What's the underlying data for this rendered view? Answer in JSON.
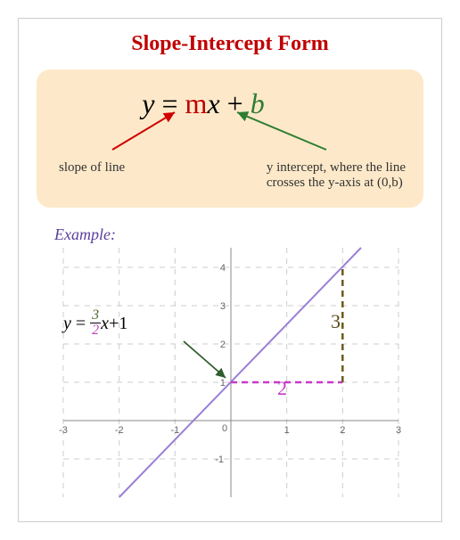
{
  "title": "Slope-Intercept Form",
  "equation": {
    "y": "y",
    "eq": " = ",
    "m": "m",
    "x": "x",
    "plus": " + ",
    "b": "b"
  },
  "annotations": {
    "slope": "slope of line",
    "intercept_line1": "y intercept, where the line",
    "intercept_line2": "crosses the y-axis at (0,b)"
  },
  "example": {
    "label": "Example:",
    "eq_y": "y",
    "eq_eq": " = ",
    "eq_frac_num": "3",
    "eq_frac_den": "2",
    "eq_x": "x",
    "eq_plus": "+",
    "eq_c": "1",
    "rise": "3",
    "run": "2"
  },
  "chart_data": {
    "type": "line",
    "title": "Example: y = (3/2)x + 1",
    "xlabel": "",
    "ylabel": "",
    "xlim": [
      -3,
      3
    ],
    "ylim": [
      -2,
      4.5
    ],
    "x_ticks": [
      -3,
      -2,
      -1,
      0,
      1,
      2,
      3
    ],
    "y_ticks": [
      -1,
      0,
      1,
      2,
      3,
      4
    ],
    "series": [
      {
        "name": "y=(3/2)x+1",
        "slope": 1.5,
        "intercept": 1,
        "points": [
          [
            -2,
            -2
          ],
          [
            0,
            1
          ],
          [
            2,
            4
          ]
        ]
      }
    ],
    "annotations": {
      "rise": {
        "from": [
          2,
          1
        ],
        "to": [
          2,
          4
        ],
        "value": 3
      },
      "run": {
        "from": [
          0,
          1
        ],
        "to": [
          2,
          1
        ],
        "value": 2
      },
      "y_intercept_point": [
        0,
        1
      ]
    }
  }
}
